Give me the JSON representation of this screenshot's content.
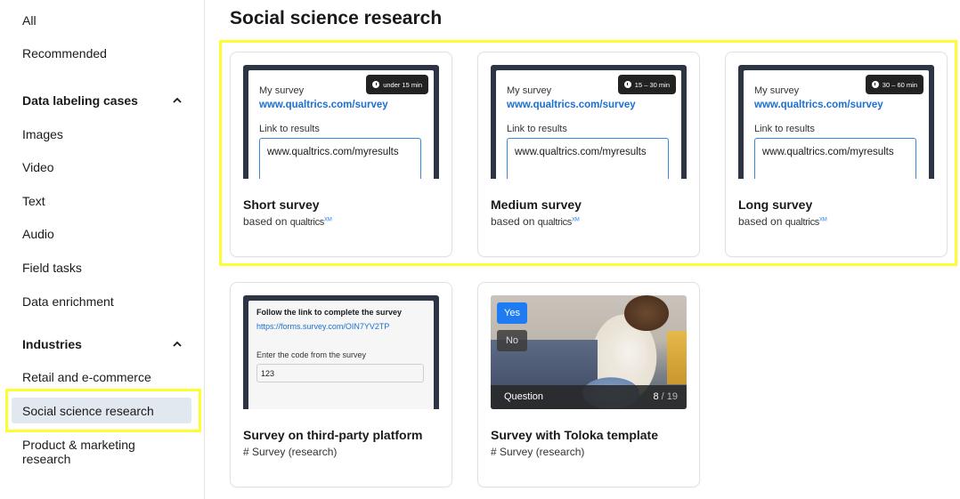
{
  "sidebar": {
    "items": {
      "all": "All",
      "recommended": "Recommended",
      "images": "Images",
      "video": "Video",
      "text": "Text",
      "audio": "Audio",
      "field_tasks": "Field tasks",
      "data_enrichment": "Data enrichment",
      "retail": "Retail and e-commerce",
      "social": "Social science research",
      "product_line1": "Product & marketing",
      "product_line2": "research"
    },
    "sections": {
      "data_labeling": "Data labeling cases",
      "industries": "Industries"
    },
    "active_item": "Social science research"
  },
  "main": {
    "title": "Social science research",
    "cards": {
      "short": {
        "title": "Short survey",
        "based_on": "based on",
        "brand": "qualtrics",
        "brand_mark": "XM",
        "badge": "under 15 min",
        "survey_label": "My survey",
        "survey_link": "www.qualtrics.com/survey",
        "results_label": "Link to results",
        "results_value": "www.qualtrics.com/myresults"
      },
      "medium": {
        "title": "Medium survey",
        "based_on": "based on",
        "brand": "qualtrics",
        "brand_mark": "XM",
        "badge": "15 – 30 min",
        "survey_label": "My survey",
        "survey_link": "www.qualtrics.com/survey",
        "results_label": "Link to results",
        "results_value": "www.qualtrics.com/myresults"
      },
      "long": {
        "title": "Long survey",
        "based_on": "based on",
        "brand": "qualtrics",
        "brand_mark": "XM",
        "badge": "30 – 60 min",
        "survey_label": "My survey",
        "survey_link": "www.qualtrics.com/survey",
        "results_label": "Link to results",
        "results_value": "www.qualtrics.com/myresults"
      },
      "third_party": {
        "title": "Survey on third-party platform",
        "tag": "# Survey (research)",
        "preview_title": "Follow the link to complete the survey",
        "preview_link": "https://forms.survey.com/OIN7YV2TP",
        "preview_label": "Enter the code from the survey",
        "preview_value": "123"
      },
      "toloka": {
        "title": "Survey with Toloka template",
        "tag": "# Survey (research)",
        "yes": "Yes",
        "no": "No",
        "question_label": "Question",
        "question_current": "8",
        "question_total": "/ 19"
      }
    }
  },
  "colors": {
    "highlight": "#fdfd32",
    "link": "#1a6fd4",
    "active_bg": "#e2e8ef",
    "yes_button": "#1f7bf2"
  }
}
